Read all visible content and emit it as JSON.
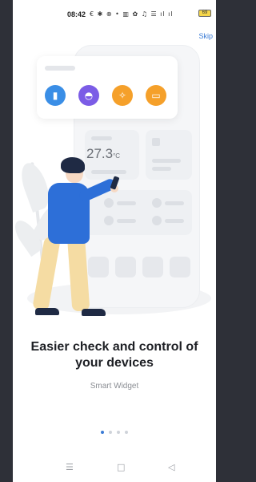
{
  "status_bar": {
    "time": "08:42",
    "icons": "€ ✱ ⊗ • ▥ ✿ ♫ ☰ ıl ıl",
    "battery": "69"
  },
  "skip_label": "Skip",
  "illustration": {
    "temperature_value": "27.3",
    "temperature_unit": "°C",
    "devices": [
      {
        "icon": "door-sensor-icon",
        "glyph": "▮",
        "color": "#3a8ee6"
      },
      {
        "icon": "lamp-icon",
        "glyph": "◓",
        "color": "#7b5ce6"
      },
      {
        "icon": "broadcast-icon",
        "glyph": "✧",
        "color": "#f5a02a"
      },
      {
        "icon": "tv-icon",
        "glyph": "▭",
        "color": "#f5a02a"
      }
    ]
  },
  "headline": "Easier check and control of your devices",
  "subtitle": "Smart Widget",
  "pager": {
    "count": 4,
    "active_index": 0
  },
  "nav": {
    "menu": "☰",
    "home": "□",
    "back": "◁"
  }
}
